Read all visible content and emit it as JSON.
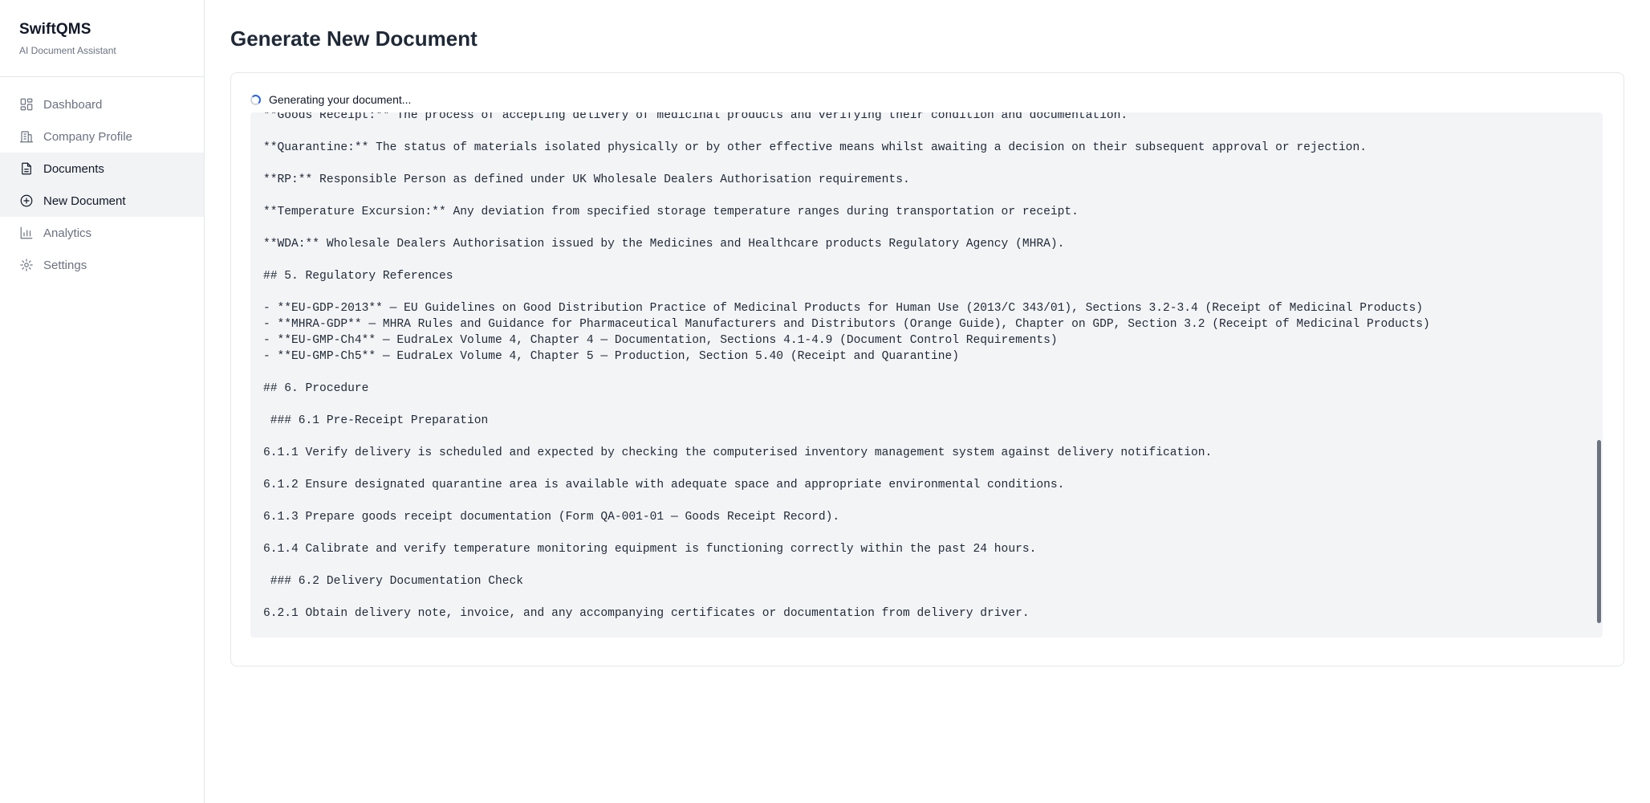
{
  "app": {
    "title": "SwiftQMS",
    "subtitle": "AI Document Assistant"
  },
  "sidebar": {
    "items": [
      {
        "label": "Dashboard",
        "icon": "dashboard-icon",
        "active": false
      },
      {
        "label": "Company Profile",
        "icon": "building-icon",
        "active": false
      },
      {
        "label": "Documents",
        "icon": "document-icon",
        "active": true
      },
      {
        "label": "New Document",
        "icon": "plus-circle-icon",
        "active": true
      },
      {
        "label": "Analytics",
        "icon": "bar-chart-icon",
        "active": false
      },
      {
        "label": "Settings",
        "icon": "gear-icon",
        "active": false
      }
    ]
  },
  "page": {
    "title": "Generate New Document"
  },
  "generation": {
    "status_text": "Generating your document...",
    "spinner_color": "#2563eb",
    "lines": [
      "**Goods Receipt:** The process of accepting delivery of medicinal products and verifying their condition and documentation.",
      "",
      "**Quarantine:** The status of materials isolated physically or by other effective means whilst awaiting a decision on their subsequent approval or rejection.",
      "",
      "**RP:** Responsible Person as defined under UK Wholesale Dealers Authorisation requirements.",
      "",
      "**Temperature Excursion:** Any deviation from specified storage temperature ranges during transportation or receipt.",
      "",
      "**WDA:** Wholesale Dealers Authorisation issued by the Medicines and Healthcare products Regulatory Agency (MHRA).",
      "",
      "## 5. Regulatory References",
      "",
      "- **EU-GDP-2013** — EU Guidelines on Good Distribution Practice of Medicinal Products for Human Use (2013/C 343/01), Sections 3.2-3.4 (Receipt of Medicinal Products)",
      "- **MHRA-GDP** — MHRA Rules and Guidance for Pharmaceutical Manufacturers and Distributors (Orange Guide), Chapter on GDP, Section 3.2 (Receipt of Medicinal Products)",
      "- **EU-GMP-Ch4** — EudraLex Volume 4, Chapter 4 — Documentation, Sections 4.1-4.9 (Document Control Requirements)",
      "- **EU-GMP-Ch5** — EudraLex Volume 4, Chapter 5 — Production, Section 5.40 (Receipt and Quarantine)",
      "",
      "## 6. Procedure",
      "",
      " ### 6.1 Pre-Receipt Preparation",
      "",
      "6.1.1 Verify delivery is scheduled and expected by checking the computerised inventory management system against delivery notification.",
      "",
      "6.1.2 Ensure designated quarantine area is available with adequate space and appropriate environmental conditions.",
      "",
      "6.1.3 Prepare goods receipt documentation (Form QA-001-01 — Goods Receipt Record).",
      "",
      "6.1.4 Calibrate and verify temperature monitoring equipment is functioning correctly within the past 24 hours.",
      "",
      " ### 6.2 Delivery Documentation Check",
      "",
      "6.2.1 Obtain delivery note, invoice, and any accompanying certificates or documentation from delivery driver."
    ]
  }
}
